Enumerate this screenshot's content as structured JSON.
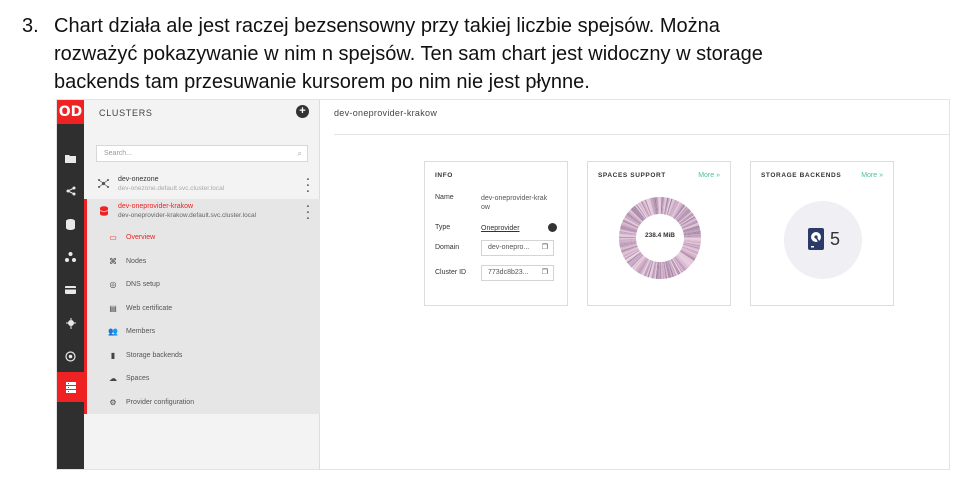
{
  "note": {
    "number": "3.",
    "line1": "Chart działa ale jest raczej bezsensowny przy takiej liczbie spejsów. Można",
    "line2": "rozważyć pokazywanie w nim n spejsów. Ten sam chart jest widoczny w storage",
    "line3": "backends tam przesuwanie kursorem po nim nie jest płynne."
  },
  "app": {
    "logo": "OD",
    "rail_icons": [
      "folder-icon",
      "share-icon",
      "database-icon",
      "groups-icon",
      "token-icon",
      "harvester-icon",
      "settings-icon",
      "clusters-icon"
    ],
    "sidebar": {
      "title": "CLUSTERS",
      "search_placeholder": "Search...",
      "clusters": [
        {
          "name": "dev-onezone",
          "domain": "dev-onezone.default.svc.cluster.local"
        },
        {
          "name": "dev-oneprovider-krakow",
          "domain": "dev-oneprovider-krakow.default.svc.cluster.local"
        }
      ],
      "menu": [
        {
          "label": "Overview",
          "icon": "overview-icon"
        },
        {
          "label": "Nodes",
          "icon": "nodes-icon"
        },
        {
          "label": "DNS setup",
          "icon": "dns-icon"
        },
        {
          "label": "Web certificate",
          "icon": "certificate-icon"
        },
        {
          "label": "Members",
          "icon": "members-icon"
        },
        {
          "label": "Storage backends",
          "icon": "storage-icon"
        },
        {
          "label": "Spaces",
          "icon": "cloud-icon"
        },
        {
          "label": "Provider configuration",
          "icon": "gear-icon"
        }
      ]
    },
    "main": {
      "title": "dev-oneprovider-krakow",
      "info": {
        "title": "INFO",
        "name_label": "Name",
        "name_value_1": "dev-oneprovider-krak",
        "name_value_2": "ow",
        "type_label": "Type",
        "type_value": "Oneprovider",
        "domain_label": "Domain",
        "domain_value": "dev-onepro...",
        "cluster_id_label": "Cluster ID",
        "cluster_id_value": "773dc8b23..."
      },
      "spaces_support": {
        "title": "SPACES SUPPORT",
        "more": "More »",
        "total": "238.4 MiB"
      },
      "storage_backends": {
        "title": "STORAGE BACKENDS",
        "more": "More »",
        "count": "5"
      }
    }
  },
  "colors": {
    "accent": "#ee2222",
    "link_green": "#4cc28e",
    "rail": "#2f2f2f"
  }
}
